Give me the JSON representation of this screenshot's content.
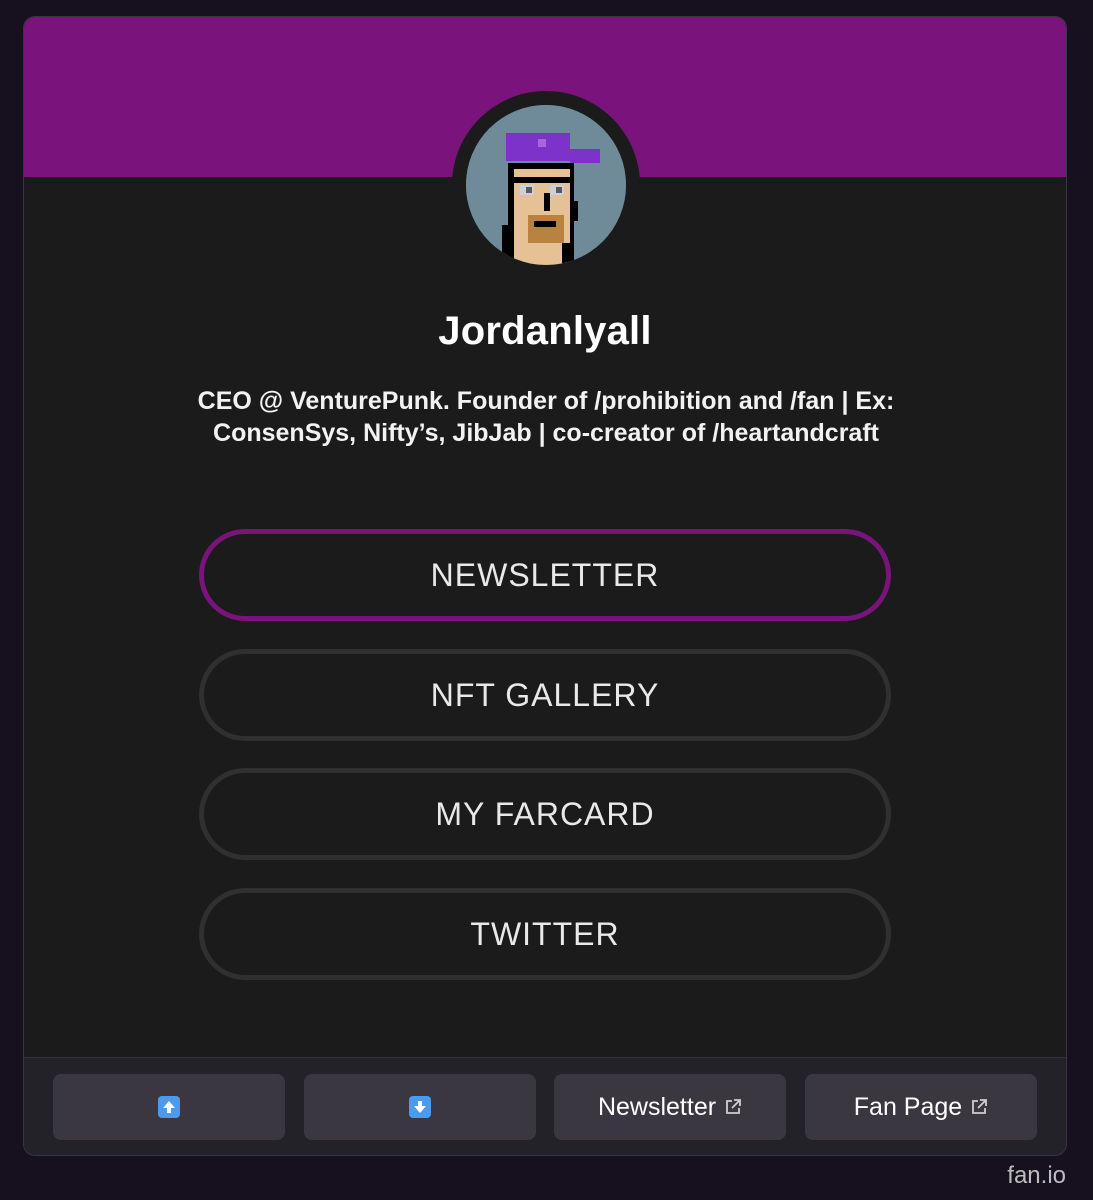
{
  "profile": {
    "name": "Jordanlyall",
    "bio_line1": "CEO @ VenturePunk. Founder of /prohibition and /fan | Ex:",
    "bio_line2": "ConsenSys, Nifty’s, JibJab | co-creator of /heartandcraft"
  },
  "links": [
    {
      "label": "NEWSLETTER",
      "active": true
    },
    {
      "label": "NFT GALLERY",
      "active": false
    },
    {
      "label": "MY FARCARD",
      "active": false
    },
    {
      "label": "TWITTER",
      "active": false
    }
  ],
  "footer": {
    "up_icon": "up-arrow-icon",
    "down_icon": "down-arrow-icon",
    "newsletter_label": "Newsletter",
    "fanpage_label": "Fan Page",
    "external_icon": "external-link-icon"
  },
  "brand": "fan.io",
  "colors": {
    "accent": "#7a137b",
    "background": "#1b1b1c",
    "page_background": "#17111f",
    "arrow_blue": "#4a9bf0"
  }
}
